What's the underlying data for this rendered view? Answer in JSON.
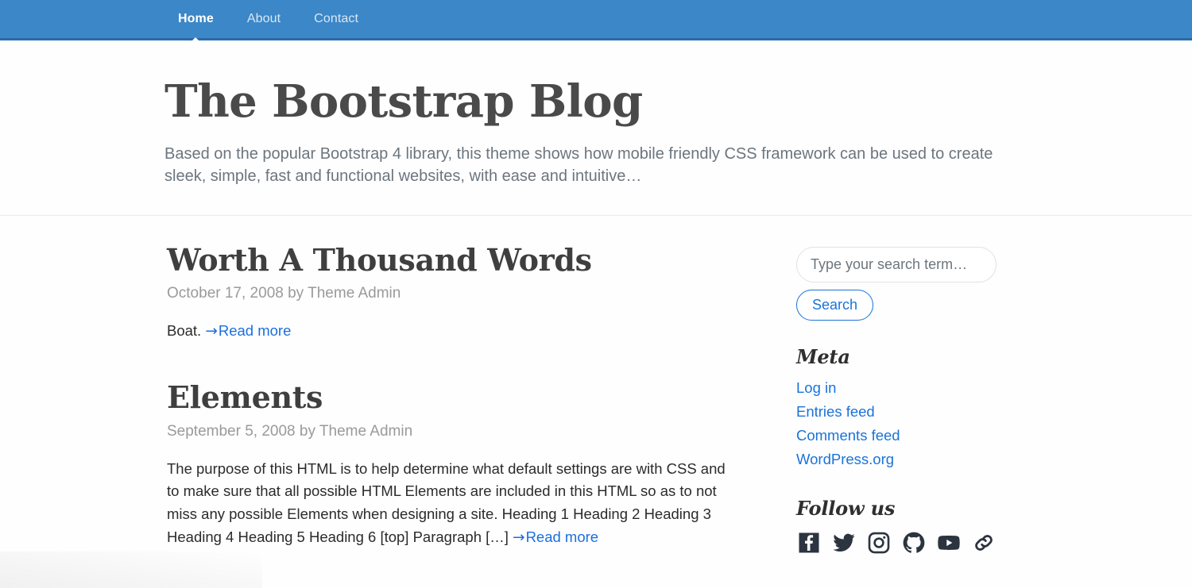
{
  "navbar": {
    "items": [
      {
        "label": "Home",
        "active": true
      },
      {
        "label": "About",
        "active": false
      },
      {
        "label": "Contact",
        "active": false
      }
    ]
  },
  "header": {
    "title": "The Bootstrap Blog",
    "description": "Based on the popular Bootstrap 4 library, this theme shows how mobile friendly CSS framework can be used to create sleek, simple, fast and functional websites, with ease and intuitive…"
  },
  "posts": [
    {
      "title": "Worth A Thousand Words",
      "date": "October 17, 2008",
      "by": "by",
      "author": "Theme Admin",
      "excerpt": "Boat. ",
      "read_more": "Read more",
      "read_more_arrow": "→"
    },
    {
      "title": "Elements",
      "date": "September 5, 2008",
      "by": "by",
      "author": "Theme Admin",
      "excerpt": "The purpose of this HTML is to help determine what default settings are with CSS and to make sure that all possible HTML Elements are included in this HTML so as to not miss any possible Elements when designing a site. Heading 1 Heading 2 Heading 3 Heading 4 Heading 5 Heading 6 [top] Paragraph […] ",
      "read_more": "Read more",
      "read_more_arrow": "→"
    }
  ],
  "sidebar": {
    "search": {
      "placeholder": "Type your search term…",
      "value": "",
      "button_label": "Search"
    },
    "meta": {
      "title": "Meta",
      "links": [
        {
          "label": "Log in"
        },
        {
          "label": "Entries feed"
        },
        {
          "label": "Comments feed"
        },
        {
          "label": "WordPress.org"
        }
      ]
    },
    "follow": {
      "title": "Follow us",
      "icons": [
        {
          "name": "facebook-icon"
        },
        {
          "name": "twitter-icon"
        },
        {
          "name": "instagram-icon"
        },
        {
          "name": "github-icon"
        },
        {
          "name": "youtube-icon"
        },
        {
          "name": "link-icon"
        }
      ]
    }
  },
  "colors": {
    "navbar_background": "#3c87c8",
    "navbar_border": "#2a6ba8",
    "link": "#1a73d8",
    "muted_text": "#6c757d",
    "heading_text": "#4a4a4a",
    "social_icon": "#2c3440"
  }
}
